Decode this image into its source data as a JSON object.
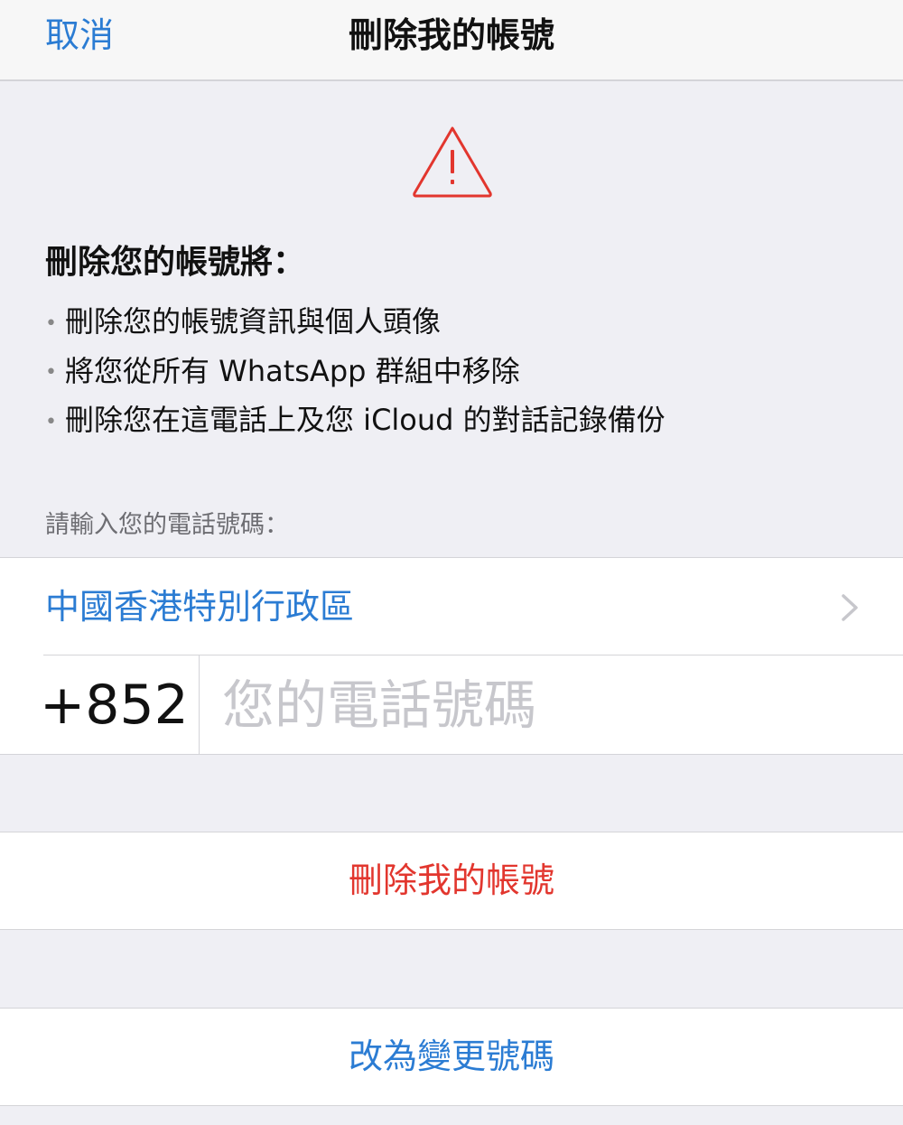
{
  "nav": {
    "cancel": "取消",
    "title": "刪除我的帳號"
  },
  "warning": {
    "icon": "warning-triangle-icon",
    "color": "#e2362e"
  },
  "info": {
    "heading": "刪除您的帳號將：",
    "bullets": [
      "刪除您的帳號資訊與個人頭像",
      "將您從所有 WhatsApp 群組中移除",
      "刪除您在這電話上及您 iCloud 的對話記錄備份"
    ]
  },
  "phone": {
    "caption": "請輸入您的電話號碼：",
    "country": "中國香港特別行政區",
    "code": "+852",
    "placeholder": "您的電話號碼",
    "value": ""
  },
  "actions": {
    "delete": "刪除我的帳號",
    "change": "改為變更號碼"
  },
  "colors": {
    "accent": "#2b7cd3",
    "destructive": "#e2362e",
    "background": "#efeff4"
  }
}
